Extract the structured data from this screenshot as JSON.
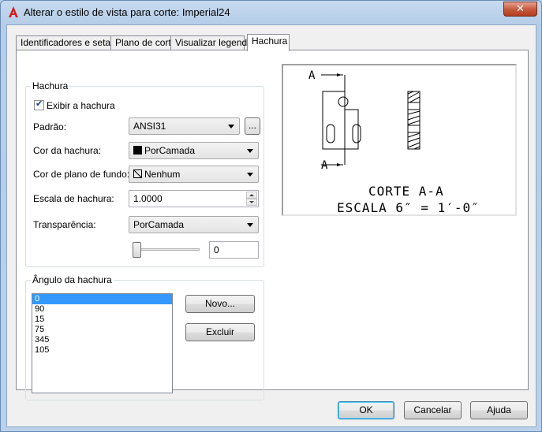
{
  "window": {
    "title": "Alterar o estilo de vista para corte: Imperial24",
    "close_glyph": "✕"
  },
  "tabs": [
    {
      "label": "Identificadores e setas",
      "active": false
    },
    {
      "label": "Plano de corte",
      "active": false
    },
    {
      "label": "Visualizar legenda",
      "active": false
    },
    {
      "label": "Hachura",
      "active": true
    }
  ],
  "hatch_group": {
    "title": "Hachura",
    "show_hatch": {
      "label": "Exibir a hachura",
      "checked": true
    },
    "pattern": {
      "label": "Padrão:",
      "value": "ANSI31",
      "browse_label": "..."
    },
    "hatch_color": {
      "label": "Cor da hachura:",
      "value": "PorCamada",
      "swatch": "#000000"
    },
    "bg_color": {
      "label": "Cor de plano de fundo:",
      "value": "Nenhum"
    },
    "scale": {
      "label": "Escala de hachura:",
      "value": "1.0000"
    },
    "transparency": {
      "label": "Transparência:",
      "value": "PorCamada"
    },
    "transparency_slider": {
      "value": 0,
      "text": "0"
    }
  },
  "angle_group": {
    "title": "Ângulo da hachura",
    "angles": [
      "0",
      "90",
      "15",
      "75",
      "345",
      "105"
    ],
    "selected_index": 0,
    "new_label": "Novo...",
    "delete_label": "Excluir"
  },
  "preview": {
    "marker_top": "A",
    "marker_bottom": "A",
    "caption_line1": "CORTE A-A",
    "caption_line2": "ESCALA 6″ = 1′-0″"
  },
  "footer": {
    "ok_label": "OK",
    "cancel_label": "Cancelar",
    "help_label": "Ajuda"
  },
  "colors": {
    "selection": "#3399ff",
    "titlebar": "#b9d1ea",
    "close": "#c75b40"
  }
}
